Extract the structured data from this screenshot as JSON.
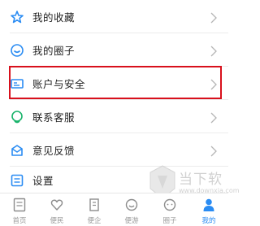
{
  "menu": {
    "items": [
      {
        "label": "我的收藏",
        "icon": "star-icon"
      },
      {
        "label": "我的圈子",
        "icon": "circle-smile-icon"
      },
      {
        "label": "账户与安全",
        "icon": "id-card-icon"
      },
      {
        "label": "联系客服",
        "icon": "headset-icon"
      },
      {
        "label": "意见反馈",
        "icon": "mail-icon"
      },
      {
        "label": "设置",
        "icon": "list-icon"
      }
    ]
  },
  "tabbar": {
    "tabs": [
      {
        "label": "首页",
        "icon": "doc-icon",
        "active": false
      },
      {
        "label": "便民",
        "icon": "heart-icon",
        "active": false
      },
      {
        "label": "便企",
        "icon": "building-icon",
        "active": false
      },
      {
        "label": "便游",
        "icon": "smile-icon",
        "active": false
      },
      {
        "label": "圈子",
        "icon": "chat-icon",
        "active": false
      },
      {
        "label": "我的",
        "icon": "user-icon",
        "active": true
      }
    ]
  },
  "watermark": {
    "text": "当下软件园",
    "url": "www.downxia.com"
  },
  "colors": {
    "accent": "#2a8cf3",
    "highlight": "#d8101c",
    "icon": "#2a8cf3"
  }
}
